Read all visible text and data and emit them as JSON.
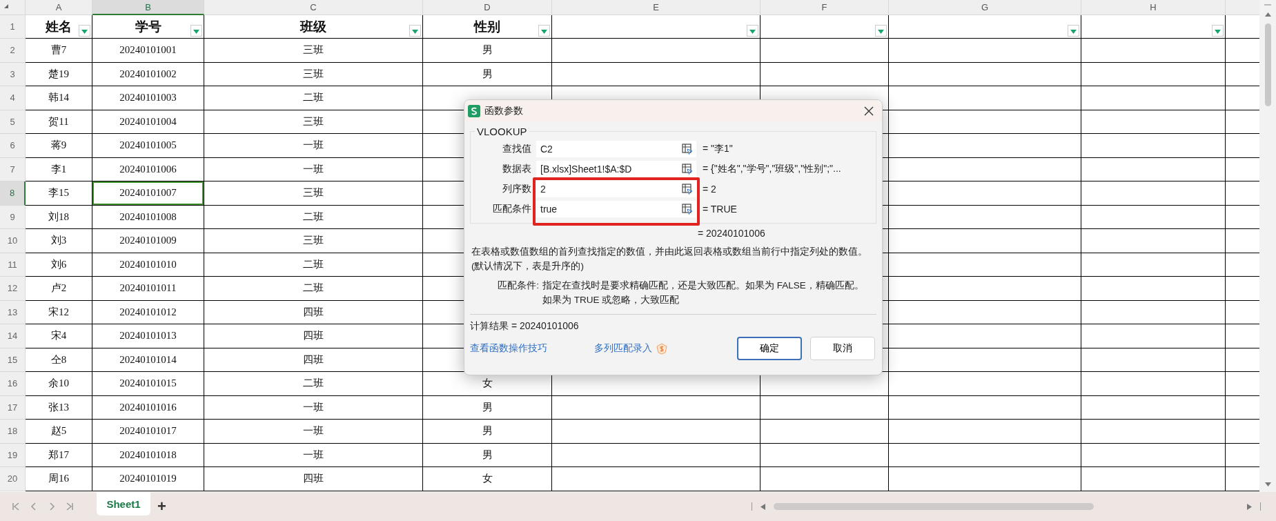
{
  "columns": [
    {
      "letter": "A",
      "selected": false,
      "filter": true
    },
    {
      "letter": "B",
      "selected": true,
      "filter": true
    },
    {
      "letter": "C",
      "selected": false,
      "filter": true
    },
    {
      "letter": "D",
      "selected": false,
      "filter": true
    },
    {
      "letter": "E",
      "selected": false,
      "filter": true
    },
    {
      "letter": "F",
      "selected": false,
      "filter": true
    },
    {
      "letter": "G",
      "selected": false,
      "filter": true
    },
    {
      "letter": "H",
      "selected": false,
      "filter": true
    }
  ],
  "header_row": {
    "number": "1",
    "selected": false,
    "cells": [
      "姓名",
      "学号",
      "班级",
      "性别"
    ]
  },
  "rows": [
    {
      "number": "2",
      "selected": false,
      "cells": [
        "曹7",
        "20240101001",
        "三班",
        "男"
      ]
    },
    {
      "number": "3",
      "selected": false,
      "cells": [
        "楚19",
        "20240101002",
        "三班",
        "男"
      ]
    },
    {
      "number": "4",
      "selected": false,
      "cells": [
        "韩14",
        "20240101003",
        "二班"
      ]
    },
    {
      "number": "5",
      "selected": false,
      "cells": [
        "贺11",
        "20240101004",
        "三班"
      ]
    },
    {
      "number": "6",
      "selected": false,
      "cells": [
        "蒋9",
        "20240101005",
        "一班"
      ]
    },
    {
      "number": "7",
      "selected": false,
      "cells": [
        "李1",
        "20240101006",
        "一班"
      ]
    },
    {
      "number": "8",
      "selected": true,
      "cells": [
        "李15",
        "20240101007",
        "三班"
      ]
    },
    {
      "number": "9",
      "selected": false,
      "cells": [
        "刘18",
        "20240101008",
        "二班"
      ]
    },
    {
      "number": "10",
      "selected": false,
      "cells": [
        "刘3",
        "20240101009",
        "三班"
      ]
    },
    {
      "number": "11",
      "selected": false,
      "cells": [
        "刘6",
        "20240101010",
        "二班"
      ]
    },
    {
      "number": "12",
      "selected": false,
      "cells": [
        "卢2",
        "20240101011",
        "二班"
      ]
    },
    {
      "number": "13",
      "selected": false,
      "cells": [
        "宋12",
        "20240101012",
        "四班"
      ]
    },
    {
      "number": "14",
      "selected": false,
      "cells": [
        "宋4",
        "20240101013",
        "四班"
      ]
    },
    {
      "number": "15",
      "selected": false,
      "cells": [
        "仝8",
        "20240101014",
        "四班"
      ]
    },
    {
      "number": "16",
      "selected": false,
      "cells": [
        "余10",
        "20240101015",
        "二班",
        "女"
      ]
    },
    {
      "number": "17",
      "selected": false,
      "cells": [
        "张13",
        "20240101016",
        "一班",
        "男"
      ]
    },
    {
      "number": "18",
      "selected": false,
      "cells": [
        "赵5",
        "20240101017",
        "一班",
        "男"
      ]
    },
    {
      "number": "19",
      "selected": false,
      "cells": [
        "郑17",
        "20240101018",
        "一班",
        "男"
      ]
    },
    {
      "number": "20",
      "selected": false,
      "cells": [
        "周16",
        "20240101019",
        "四班",
        "女"
      ]
    }
  ],
  "sheet_tabs": [
    {
      "label": "Sheet1",
      "selected": true
    }
  ],
  "add_sheet": "+",
  "dialog": {
    "title": "函数参数",
    "function": "VLOOKUP",
    "arguments": [
      {
        "label": "查找值",
        "value": "C2",
        "result": "= \"李1\""
      },
      {
        "label": "数据表",
        "value": "[B.xlsx]Sheet1!$A:$D",
        "result": "= {\"姓名\",\"学号\",\"班级\",\"性别\";\"..."
      },
      {
        "label": "列序数",
        "value": "2",
        "result": "= 2"
      },
      {
        "label": "匹配条件",
        "value": "true",
        "result": "= TRUE"
      }
    ],
    "formula_result": "= 20240101006",
    "description": "在表格或数值数组的首列查找指定的数值，并由此返回表格或数组当前行中指定列处的数值。 (默认情况下，表是升序的)",
    "argument_help": {
      "label": "匹配条件:",
      "text": "指定在查找时是要求精确匹配，还是大致匹配。如果为 FALSE，精确匹配。如果为 TRUE 或忽略，大致匹配"
    },
    "calc_result": "计算结果 = 20240101006",
    "links": [
      {
        "label": "查看函数操作技巧",
        "badge": false
      },
      {
        "label": "多列匹配录入",
        "badge": true
      }
    ],
    "buttons": [
      {
        "label": "确定",
        "default": true
      },
      {
        "label": "取消",
        "default": false
      }
    ]
  }
}
